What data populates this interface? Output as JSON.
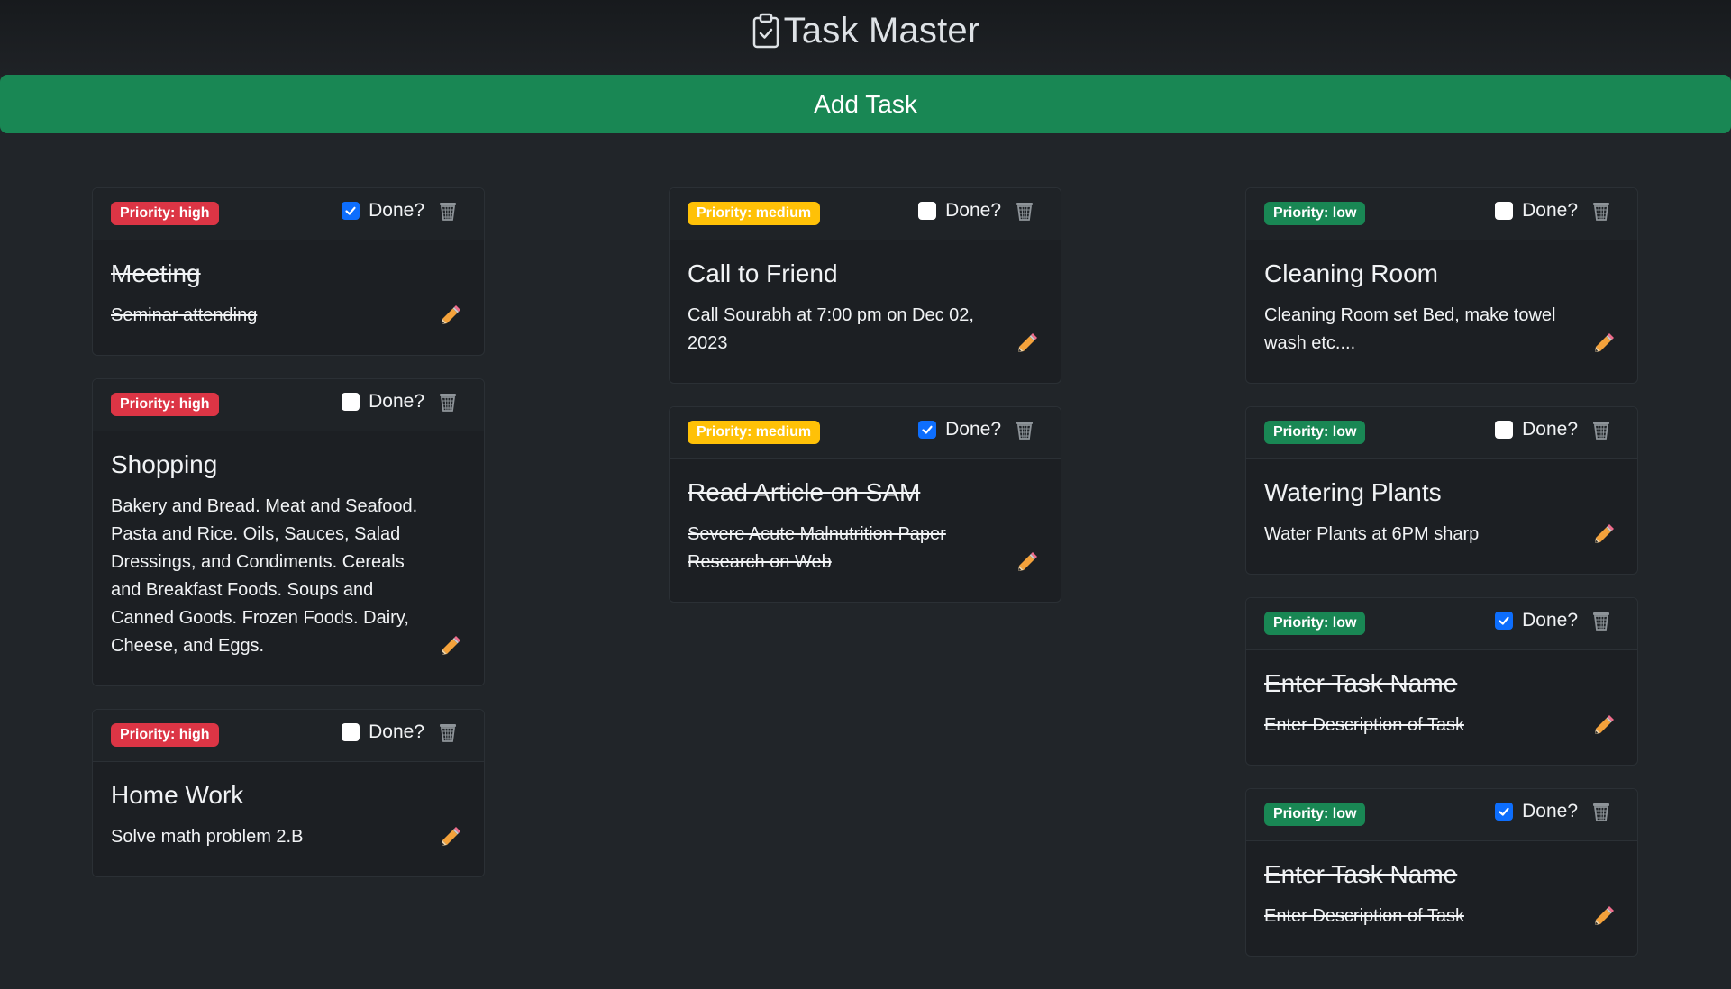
{
  "app": {
    "title": "Task Master",
    "add_button_label": "Add Task"
  },
  "colors": {
    "background": "#212529",
    "add_button": "#198754",
    "priority_high": "#dc3545",
    "priority_medium": "#ffc107",
    "priority_low": "#198754",
    "checkbox_checked": "#0d6efd"
  },
  "columns": [
    {
      "cards": [
        {
          "priority": "Priority: high",
          "done_label": "Done?",
          "done": true,
          "name": "Meeting",
          "description": "Seminar attending"
        },
        {
          "priority": "Priority: high",
          "done_label": "Done?",
          "done": false,
          "name": "Shopping",
          "description": "Bakery and Bread. Meat and Seafood. Pasta and Rice. Oils, Sauces, Salad Dressings, and Condiments. Cereals and Breakfast Foods. Soups and Canned Goods. Frozen Foods. Dairy, Cheese, and Eggs."
        },
        {
          "priority": "Priority: high",
          "done_label": "Done?",
          "done": false,
          "name": "Home Work",
          "description": "Solve math problem 2.B"
        }
      ]
    },
    {
      "cards": [
        {
          "priority": "Priority: medium",
          "done_label": "Done?",
          "done": false,
          "name": "Call to Friend",
          "description": "Call Sourabh at 7:00 pm on Dec 02, 2023"
        },
        {
          "priority": "Priority: medium",
          "done_label": "Done?",
          "done": true,
          "name": "Read Article on SAM",
          "description": "Severe Acute Malnutrition Paper Research on Web"
        }
      ]
    },
    {
      "cards": [
        {
          "priority": "Priority: low",
          "done_label": "Done?",
          "done": false,
          "name": "Cleaning Room",
          "description": "Cleaning Room set Bed, make towel wash etc...."
        },
        {
          "priority": "Priority: low",
          "done_label": "Done?",
          "done": false,
          "name": "Watering Plants",
          "description": "Water Plants at 6PM sharp"
        },
        {
          "priority": "Priority: low",
          "done_label": "Done?",
          "done": true,
          "name": "Enter Task Name",
          "description": "Enter Description of Task"
        },
        {
          "priority": "Priority: low",
          "done_label": "Done?",
          "done": true,
          "name": "Enter Task Name",
          "description": "Enter Description of Task"
        }
      ]
    }
  ]
}
